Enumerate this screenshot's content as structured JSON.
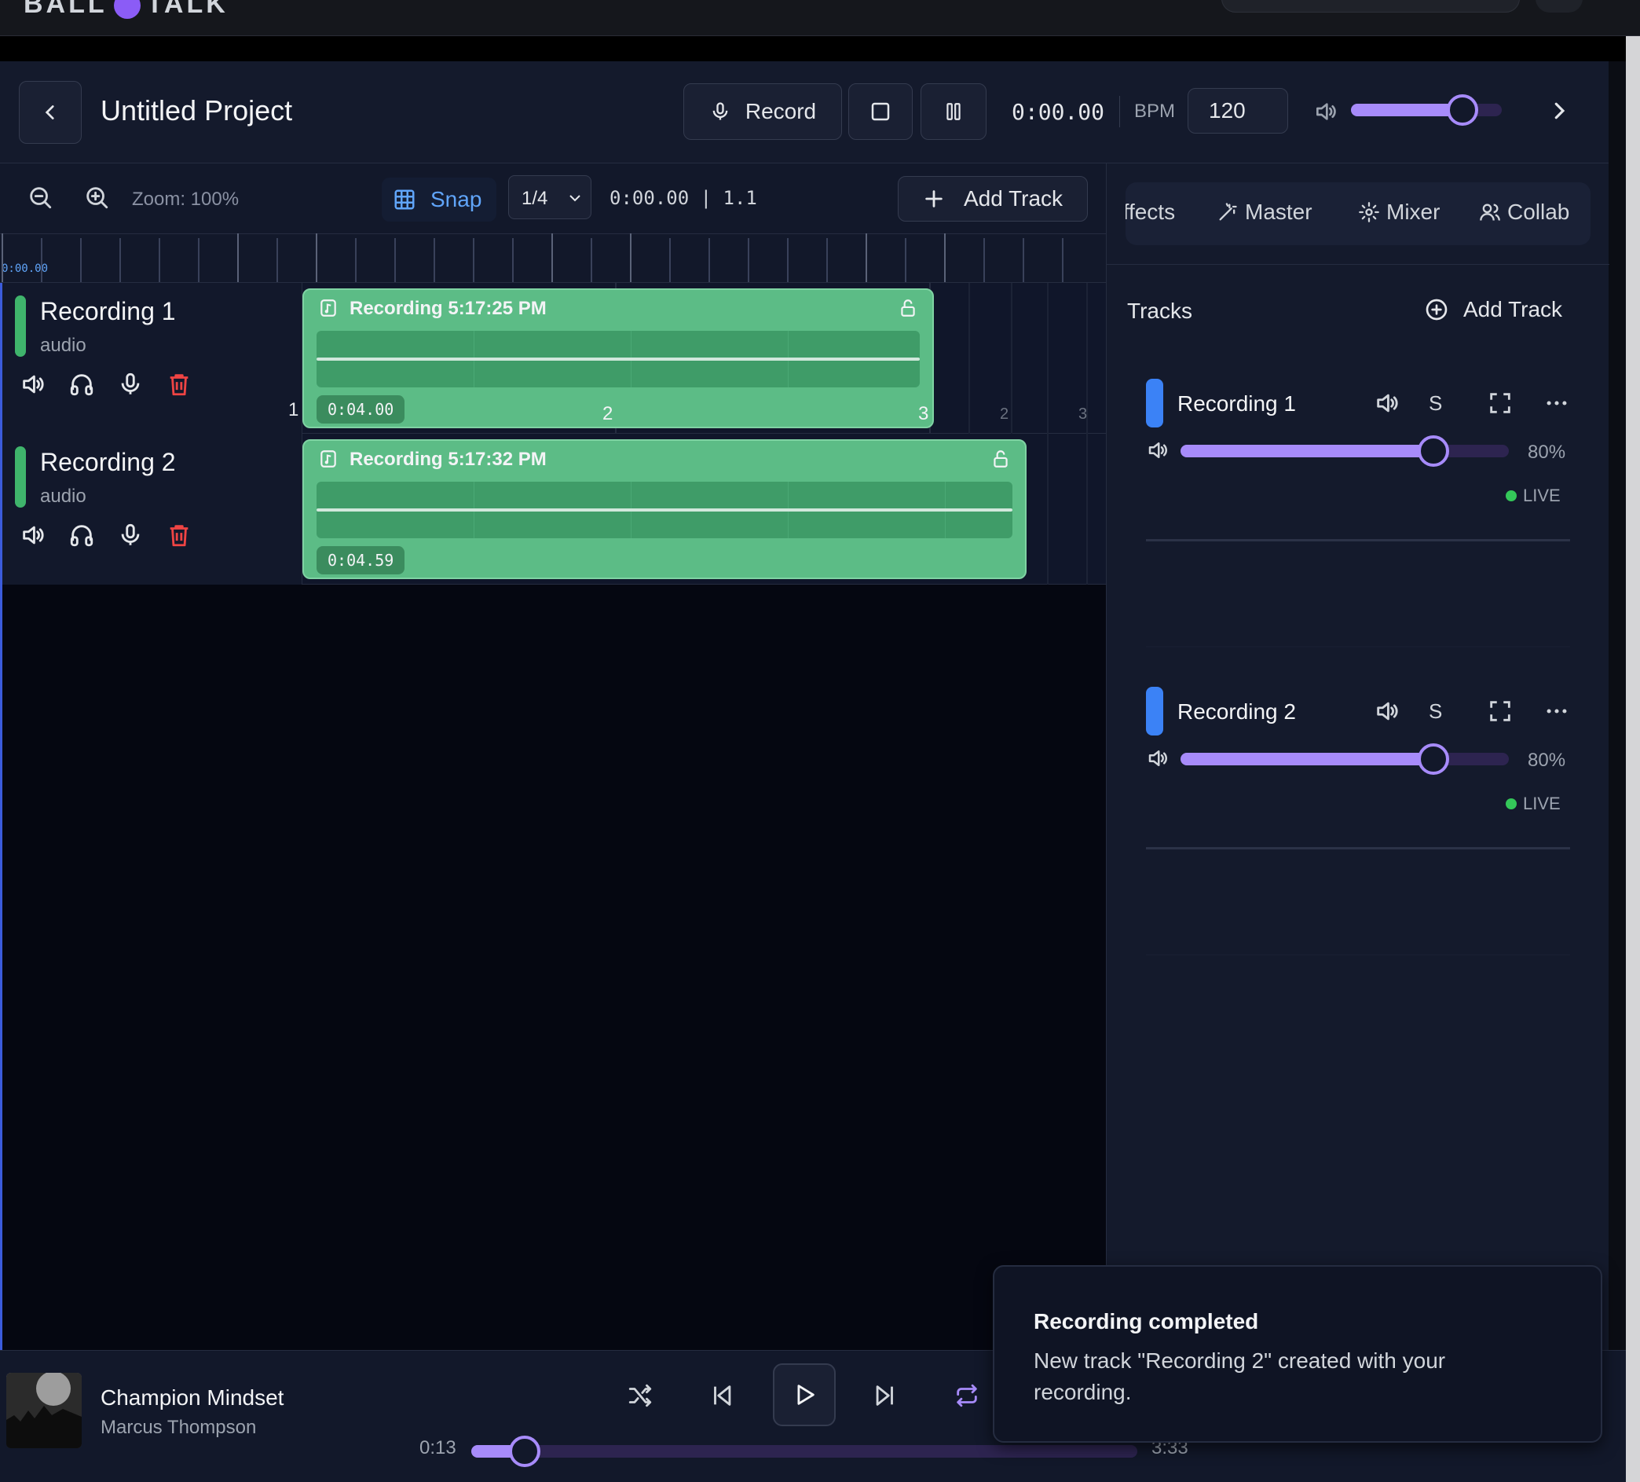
{
  "app": {
    "logo_left": "BALL",
    "logo_right": "TALK"
  },
  "header": {
    "title": "Untitled Project",
    "record_label": "Record",
    "timecode": "0:00.00",
    "bpm_label": "BPM",
    "bpm_value": "120",
    "master_volume": 0.74
  },
  "toolbar": {
    "zoom_label": "Zoom: 100%",
    "snap_label": "Snap",
    "snap_value": "1/4",
    "position": "0:00.00 | 1.1",
    "add_track_label": "Add Track"
  },
  "ruler": {
    "start_label": "0:00.00"
  },
  "tracks": [
    {
      "name": "Recording 1",
      "type": "audio",
      "clip_title": "Recording 5:17:25 PM",
      "clip_duration": "0:04.00"
    },
    {
      "name": "Recording 2",
      "type": "audio",
      "clip_title": "Recording 5:17:32 PM",
      "clip_duration": "0:04.59"
    }
  ],
  "grid_numbers": {
    "bar1": "1",
    "bar2": "2",
    "bar3": "3",
    "beat2": "2",
    "beat3": "3"
  },
  "right_panel": {
    "tabs": [
      "Effects",
      "Master",
      "Mixer",
      "Collab"
    ],
    "heading": "Tracks",
    "add_track_label": "Add Track",
    "mixer_tracks": [
      {
        "name": "Recording 1",
        "solo_label": "S",
        "volume_pct": "80%",
        "volume": 0.77,
        "status": "LIVE"
      },
      {
        "name": "Recording 2",
        "solo_label": "S",
        "volume_pct": "80%",
        "volume": 0.77,
        "status": "LIVE"
      }
    ]
  },
  "player": {
    "song_title": "Champion Mindset",
    "artist": "Marcus Thompson",
    "elapsed": "0:13",
    "total": "3:33",
    "progress": 0.08
  },
  "toast": {
    "title": "Recording completed",
    "body": "New track \"Recording 2\" created with your recording."
  },
  "colors": {
    "accent": "#a78bfa",
    "clip": "#5cbc86",
    "track_marker": "#3fb46c",
    "mixer_marker": "#3b82f6",
    "delete": "#ef4444",
    "live": "#34c759"
  }
}
